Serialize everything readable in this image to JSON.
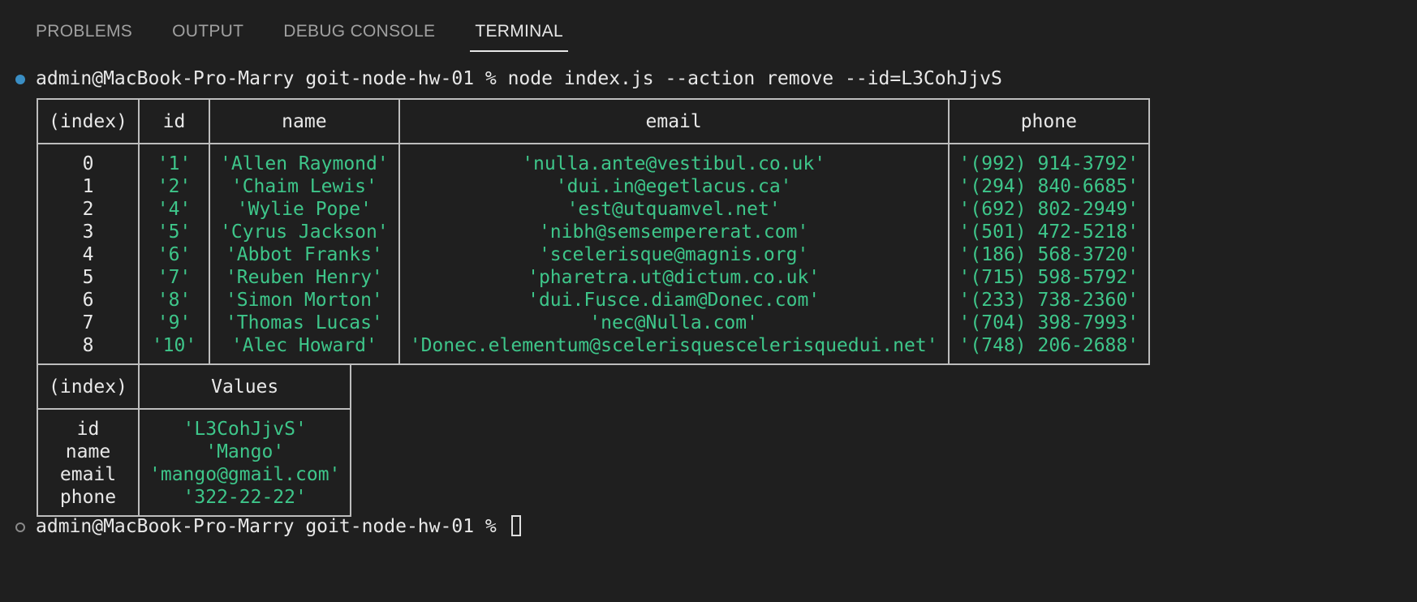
{
  "tabs": [
    {
      "label": "PROBLEMS",
      "active": false
    },
    {
      "label": "OUTPUT",
      "active": false
    },
    {
      "label": "DEBUG CONSOLE",
      "active": false
    },
    {
      "label": "TERMINAL",
      "active": true
    }
  ],
  "terminal": {
    "command_line": "admin@MacBook-Pro-Marry goit-node-hw-01 % node index.js --action remove --id=L3CohJjvS",
    "prompt_line": "admin@MacBook-Pro-Marry goit-node-hw-01 % ",
    "contacts_table": {
      "headers": [
        "(index)",
        "id",
        "name",
        "email",
        "phone"
      ],
      "rows": [
        [
          "0",
          "'1'",
          "'Allen Raymond'",
          "'nulla.ante@vestibul.co.uk'",
          "'(992) 914-3792'"
        ],
        [
          "1",
          "'2'",
          "'Chaim Lewis'",
          "'dui.in@egetlacus.ca'",
          "'(294) 840-6685'"
        ],
        [
          "2",
          "'4'",
          "'Wylie Pope'",
          "'est@utquamvel.net'",
          "'(692) 802-2949'"
        ],
        [
          "3",
          "'5'",
          "'Cyrus Jackson'",
          "'nibh@semsempererat.com'",
          "'(501) 472-5218'"
        ],
        [
          "4",
          "'6'",
          "'Abbot Franks'",
          "'scelerisque@magnis.org'",
          "'(186) 568-3720'"
        ],
        [
          "5",
          "'7'",
          "'Reuben Henry'",
          "'pharetra.ut@dictum.co.uk'",
          "'(715) 598-5792'"
        ],
        [
          "6",
          "'8'",
          "'Simon Morton'",
          "'dui.Fusce.diam@Donec.com'",
          "'(233) 738-2360'"
        ],
        [
          "7",
          "'9'",
          "'Thomas Lucas'",
          "'nec@Nulla.com'",
          "'(704) 398-7993'"
        ],
        [
          "8",
          "'10'",
          "'Alec Howard'",
          "'Donec.elementum@scelerisquescelerisquedui.net'",
          "'(748) 206-2688'"
        ]
      ]
    },
    "removed_table": {
      "headers": [
        "(index)",
        "Values"
      ],
      "rows": [
        [
          "id",
          "'L3CohJjvS'"
        ],
        [
          "name",
          "'Mango'"
        ],
        [
          "email",
          "'mango@gmail.com'"
        ],
        [
          "phone",
          "'322-22-22'"
        ]
      ]
    }
  },
  "colors": {
    "background": "#1f1f1f",
    "string_value": "#3ec68a",
    "status_dot_success": "#3a8ec4"
  }
}
